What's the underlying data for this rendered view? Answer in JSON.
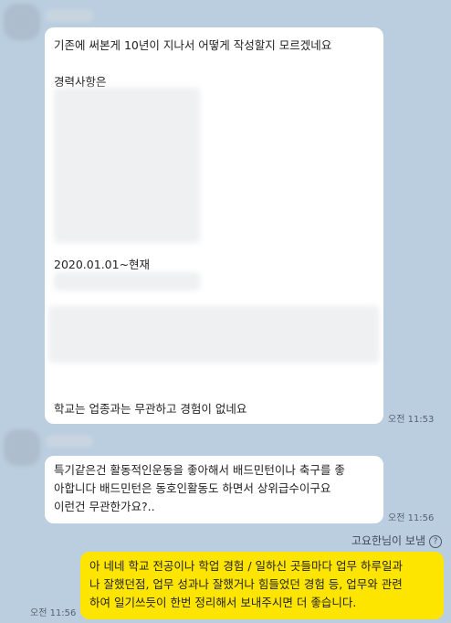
{
  "messages": [
    {
      "lines": [
        "기존에 써본게 10년이 지나서 어떻게 작성할지 모르겠네요",
        "경력사항은",
        "2020.01.01~현재",
        "학교는 업종과는 무관하고 경험이 없네요"
      ],
      "time": "오전 11:53"
    },
    {
      "lines": [
        "특기같은건 활동적인운동을 좋아해서 배드민턴이나 축구를 좋",
        "아합니다 배드민턴은 동호인활동도 하면서 상위급수이구요",
        "이런건 무관한가요?.."
      ],
      "time": "오전 11:56"
    }
  ],
  "sent": {
    "sender_label": "고요한님이 보냄",
    "lines": [
      "아 네네 학교 전공이나 학업 경험 / 일하신 곳들마다 업무 하루일과",
      "나 잘했던점, 업무 성과나 잘했거나 힘들었던 경험 등, 업무와 관련",
      "하여 일기쓰듯이 한번 정리해서 보내주시면 더 좋습니다."
    ],
    "time": "오전 11:56"
  }
}
